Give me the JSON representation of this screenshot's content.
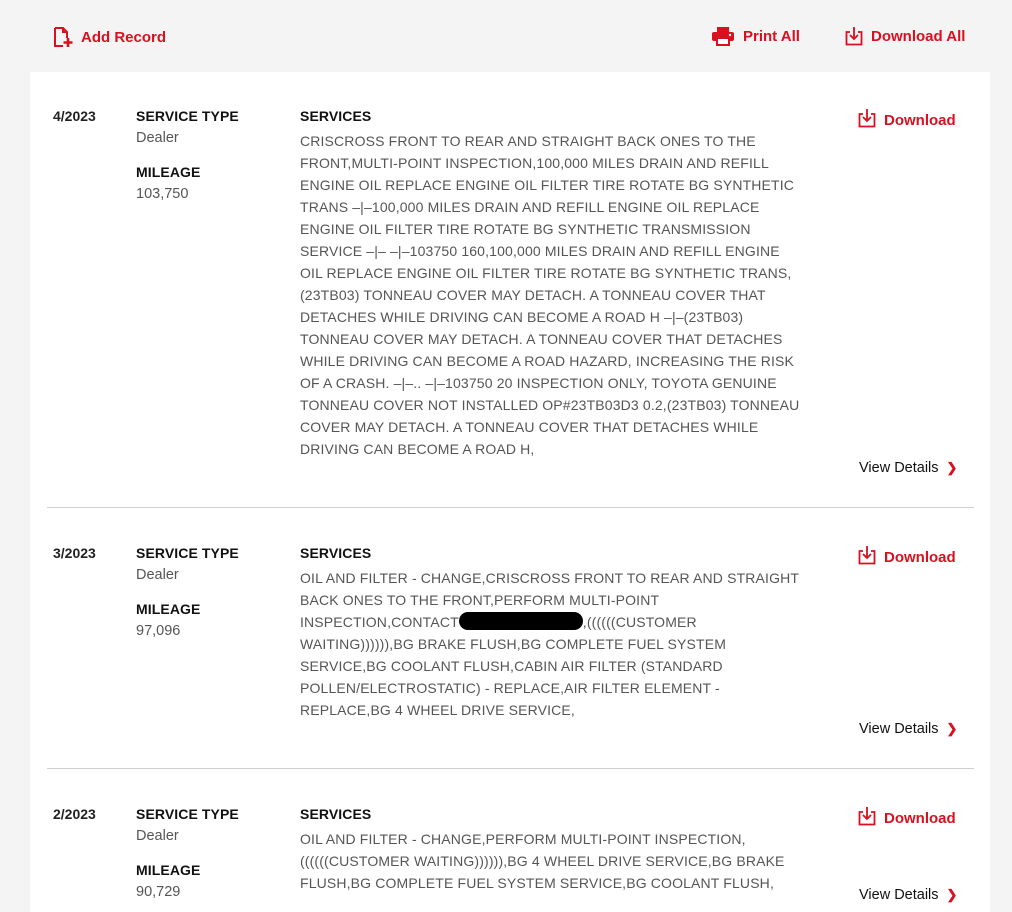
{
  "toolbar": {
    "add_record_label": "Add Record",
    "print_all_label": "Print All",
    "download_all_label": "Download All"
  },
  "labels": {
    "service_type": "SERVICE TYPE",
    "mileage": "MILEAGE",
    "services": "SERVICES",
    "download": "Download",
    "view_details": "View Details"
  },
  "records": [
    {
      "date": "4/2023",
      "service_type": "Dealer",
      "mileage": "103,750",
      "services": "CRISCROSS FRONT TO REAR AND STRAIGHT BACK ONES TO THE FRONT,MULTI-POINT INSPECTION,100,000 MILES DRAIN AND REFILL ENGINE OIL REPLACE ENGINE OIL FILTER TIRE ROTATE BG SYNTHETIC TRANS –|–100,000 MILES DRAIN AND REFILL ENGINE OIL REPLACE ENGINE OIL FILTER TIRE ROTATE BG SYNTHETIC TRANSMISSION SERVICE –|– –|–103750 160,100,000 MILES DRAIN AND REFILL ENGINE OIL REPLACE ENGINE OIL FILTER TIRE ROTATE BG SYNTHETIC TRANS,(23TB03) TONNEAU COVER MAY DETACH. A TONNEAU COVER THAT DETACHES WHILE DRIVING CAN BECOME A ROAD H –|–(23TB03) TONNEAU COVER MAY DETACH. A TONNEAU COVER THAT DETACHES WHILE DRIVING CAN BECOME A ROAD HAZARD, INCREASING THE RISK OF A CRASH. –|–.. –|–103750 20 INSPECTION ONLY, TOYOTA GENUINE TONNEAU COVER NOT INSTALLED OP#23TB03D3 0.2,(23TB03) TONNEAU COVER MAY DETACH. A TONNEAU COVER THAT DETACHES WHILE DRIVING CAN BECOME A ROAD H,"
    },
    {
      "date": "3/2023",
      "service_type": "Dealer",
      "mileage": "97,096",
      "services_before": "OIL AND FILTER - CHANGE,CRISCROSS FRONT TO REAR AND STRAIGHT BACK ONES TO THE FRONT,PERFORM MULTI-POINT INSPECTION,CONTACT",
      "services_after": ",((((((CUSTOMER WAITING)))))),BG BRAKE FLUSH,BG COMPLETE FUEL SYSTEM SERVICE,BG COOLANT FLUSH,CABIN AIR FILTER (STANDARD POLLEN/ELECTROSTATIC) - REPLACE,AIR FILTER ELEMENT - REPLACE,BG 4 WHEEL DRIVE SERVICE,"
    },
    {
      "date": "2/2023",
      "service_type": "Dealer",
      "mileage": "90,729",
      "services": "OIL AND FILTER - CHANGE,PERFORM MULTI-POINT INSPECTION, ((((((CUSTOMER WAITING)))))),BG 4 WHEEL DRIVE SERVICE,BG BRAKE FLUSH,BG COMPLETE FUEL SYSTEM SERVICE,BG COOLANT FLUSH,"
    }
  ],
  "colors": {
    "accent": "#d8101f",
    "background": "#f4f4f4",
    "panel": "#ffffff"
  },
  "icons": [
    "add-document-icon",
    "printer-icon",
    "download-icon",
    "chevron-right-icon",
    "redaction-mark"
  ]
}
